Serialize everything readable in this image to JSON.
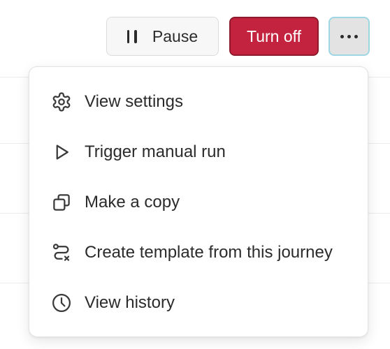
{
  "toolbar": {
    "pause_label": "Pause",
    "turn_off_label": "Turn off",
    "turn_off_color": "#c4233f",
    "more_icon": "more-horizontal-icon"
  },
  "menu": {
    "items": [
      {
        "label": "View settings",
        "icon": "gear-icon"
      },
      {
        "label": "Trigger manual run",
        "icon": "play-icon"
      },
      {
        "label": "Make a copy",
        "icon": "copy-icon"
      },
      {
        "label": "Create template from this journey",
        "icon": "route-template-icon"
      },
      {
        "label": "View history",
        "icon": "clock-icon"
      }
    ]
  }
}
